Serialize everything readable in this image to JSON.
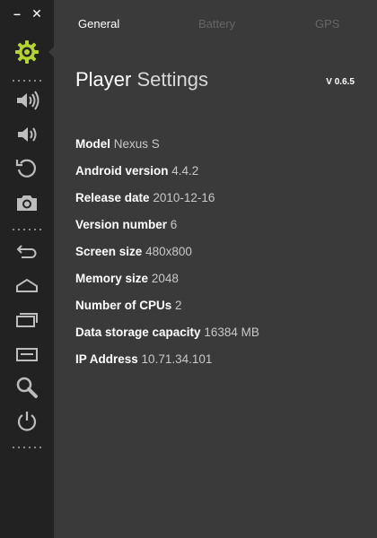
{
  "window": {
    "minimize_label": "–",
    "close_label": "✕"
  },
  "colors": {
    "accent": "#b4d334",
    "sidebar_bg": "#222222",
    "content_bg": "#3a3a3a",
    "icon": "#bdbdbd"
  },
  "sidebar": {
    "items": [
      {
        "name": "settings",
        "icon": "gear-icon"
      },
      {
        "name": "volume-up",
        "icon": "volume-up-icon"
      },
      {
        "name": "volume-down",
        "icon": "volume-down-icon"
      },
      {
        "name": "rotate",
        "icon": "rotate-icon"
      },
      {
        "name": "camera",
        "icon": "camera-icon"
      },
      {
        "name": "back",
        "icon": "back-icon"
      },
      {
        "name": "home",
        "icon": "home-icon"
      },
      {
        "name": "recent-apps",
        "icon": "recent-apps-icon"
      },
      {
        "name": "menu",
        "icon": "menu-icon"
      },
      {
        "name": "search",
        "icon": "search-icon"
      },
      {
        "name": "power",
        "icon": "power-icon"
      }
    ]
  },
  "tabs": [
    {
      "label": "General",
      "active": true
    },
    {
      "label": "Battery",
      "active": false
    },
    {
      "label": "GPS",
      "active": false
    }
  ],
  "header": {
    "title_strong": "Player",
    "title_light": "Settings",
    "version": "V 0.6.5"
  },
  "info": [
    {
      "label": "Model",
      "value": "Nexus S"
    },
    {
      "label": "Android version",
      "value": "4.4.2"
    },
    {
      "label": "Release date",
      "value": "2010-12-16"
    },
    {
      "label": "Version number",
      "value": "6"
    },
    {
      "label": "Screen size",
      "value": "480x800"
    },
    {
      "label": "Memory size",
      "value": "2048"
    },
    {
      "label": "Number of CPUs",
      "value": "2"
    },
    {
      "label": "Data storage capacity",
      "value": "16384 MB"
    },
    {
      "label": "IP Address",
      "value": "10.71.34.101"
    }
  ]
}
